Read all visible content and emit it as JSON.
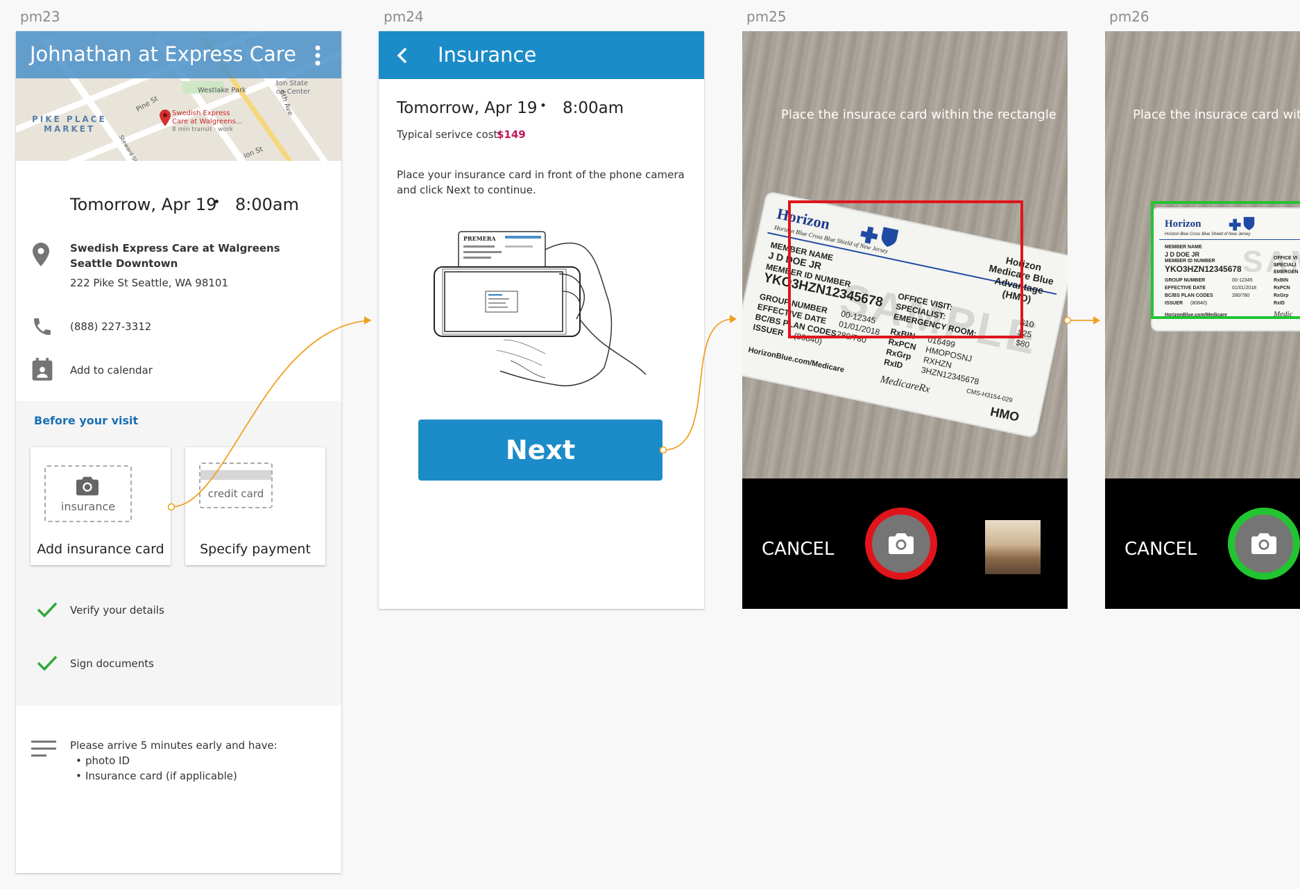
{
  "frames": {
    "pm23": "pm23",
    "pm24": "pm24",
    "pm25": "pm25",
    "pm26": "pm26"
  },
  "pm23": {
    "title": "Johnathan at Express Care",
    "map": {
      "labels": [
        "Westlake Park",
        "PIKE PLACE",
        "MARKET",
        "Swedish Express",
        "Care at Walgreens...",
        "8 min transit · work",
        "Pine St",
        "6th Ave",
        "ton State",
        "on Center",
        "ion St",
        "Steward St"
      ]
    },
    "date": "Tomorrow, Apr 19",
    "dot": "•",
    "time": "8:00am",
    "location_name": "Swedish Express Care at Walgreens Seattle Downtown",
    "address": "222 Pike St  Seattle, WA 98101",
    "phone": "(888) 227-3312",
    "calendar": "Add to calendar",
    "before_visit": "Before your visit",
    "card_insurance_placeholder": "insurance",
    "card_insurance_label": "Add insurance card",
    "card_payment_placeholder": "credit card",
    "card_payment_label": "Specify payment",
    "check1": "Verify your details",
    "check2": "Sign documents",
    "note_title": "Please arrive 5 minutes early and have:",
    "note_items": [
      "photo ID",
      "Insurance card (if applicable)"
    ],
    "colors": {
      "appbar": "#4a90c9",
      "accent": "#1a6fb3",
      "check": "#2eaa3a"
    }
  },
  "pm24": {
    "title": "Insurance",
    "date": "Tomorrow, Apr 19",
    "dot": "•",
    "time": "8:00am",
    "cost_label": "Typical serivce cost:",
    "cost_value": "$149",
    "instructions": "Place your insurance card in front of the phone camera and click Next to continue.",
    "illustration_brand": "PREMERA",
    "next": "Next",
    "colors": {
      "appbar": "#1b8cc7",
      "cost": "#c2185b"
    }
  },
  "pm25": {
    "hint": "Place the insurace card within the rectangle",
    "cancel": "CANCEL",
    "frame_color": "#e0151b",
    "card": {
      "brand": "Horizon",
      "brand_sub": "Horizon Blue Cross Blue Shield of New Jersey",
      "plan": [
        "Horizon",
        "Medicare Blue",
        "Advantage",
        "(HMO)"
      ],
      "member_name_label": "MEMBER NAME",
      "member_name": "J D DOE JR",
      "member_id_label": "MEMBER ID NUMBER",
      "member_id": "YKO3HZN12345678",
      "group_label": "GROUP NUMBER",
      "group": "00-12345",
      "effective_label": "EFFECTIVE DATE",
      "effective": "01/01/2018",
      "bcbs_label": "BC/BS PLAN CODES",
      "bcbs": "280/780",
      "issuer_label": "ISSUER",
      "issuer": "(80840)",
      "office_label": "OFFICE VISIT:",
      "specialist_label": "SPECIALIST:",
      "er_label": "EMERGENCY ROOM:",
      "copays": [
        "$10",
        "$25",
        "$80"
      ],
      "rxbin_label": "RxBIN",
      "rxbin": "016499",
      "rxpcn_label": "RxPCN",
      "rxpcn": "HMOPOSNJ",
      "rxgrp_label": "RxGrp",
      "rxgrp": "RXHZN",
      "rxid_label": "RxID",
      "rxid": "3HZN12345678",
      "cms": "CMS-H3154-029",
      "url": "HorizonBlue.com/Medicare",
      "medicarerx": "MedicareRx",
      "hmo": "HMO",
      "sample": "SAMPLE"
    }
  },
  "pm26": {
    "hint": "Place the insurace card wit",
    "cancel": "CANCEL",
    "frame_color": "#22c431",
    "card": {
      "brand": "Horizon",
      "brand_sub": "Horizon Blue Cross Blue Shield of New Jersey",
      "member_name_label": "MEMBER NAME",
      "member_name": "J D DOE JR",
      "member_id_label": "MEMBER ID NUMBER",
      "member_id": "YKO3HZN12345678",
      "group_label": "GROUP NUMBER",
      "group": "00-12345",
      "effective_label": "EFFECTIVE DATE",
      "effective": "01/01/2018",
      "bcbs_label": "BC/BS PLAN CODES",
      "bcbs": "280/780",
      "issuer_label": "ISSUER",
      "issuer": "(80840)",
      "office_label": "OFFICE VI",
      "specialist_label": "SPECIALI",
      "er_label": "EMERGEN",
      "rxbin_label": "RxBIN",
      "rxpcn_label": "RxPCN",
      "rxgrp_label": "RxGrp",
      "rxid_label": "RxID",
      "url": "HorizonBlue.com/Medicare",
      "medi": "Medic"
    }
  }
}
